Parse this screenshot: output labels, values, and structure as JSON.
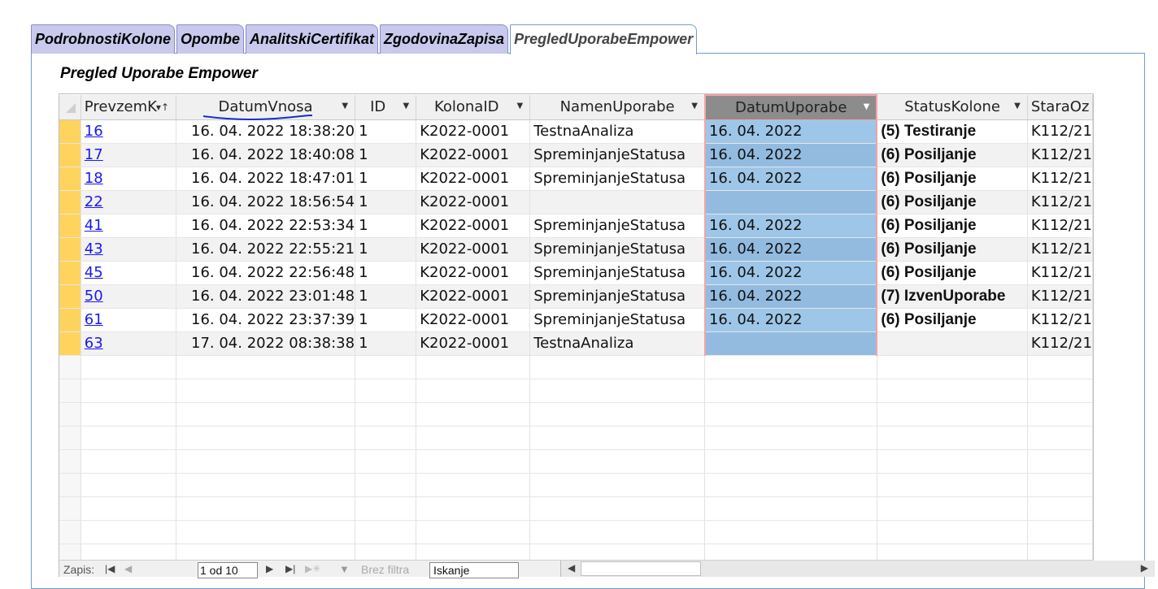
{
  "tabs": [
    {
      "label": "PodrobnostiKolone",
      "active": false
    },
    {
      "label": "Opombe",
      "active": false
    },
    {
      "label": "AnalitskiCertifikat",
      "active": false
    },
    {
      "label": "ZgodovinaZapisa",
      "active": false
    },
    {
      "label": "PregledUporabeEmpower",
      "active": true
    }
  ],
  "panel_title": "Pregled Uporabe Empower",
  "columns": [
    "PrevzemK",
    "DatumVnosa",
    "ID",
    "KolonaID",
    "NamenUporabe",
    "DatumUporabe",
    "StatusKolone",
    "StaraOz"
  ],
  "rows": [
    {
      "prevzem": "16",
      "datum_vnosa": "16. 04. 2022 18:38:20",
      "id": "1",
      "kolona": "K2022-0001",
      "namen": "TestnaAnaliza",
      "datum_uporabe": "16. 04. 2022",
      "status": "(5) Testiranje",
      "stara": "K112/21"
    },
    {
      "prevzem": "17",
      "datum_vnosa": "16. 04. 2022 18:40:08",
      "id": "1",
      "kolona": "K2022-0001",
      "namen": "SpreminjanjeStatusa",
      "datum_uporabe": "16. 04. 2022",
      "status": "(6) Posiljanje",
      "stara": "K112/21"
    },
    {
      "prevzem": "18",
      "datum_vnosa": "16. 04. 2022 18:47:01",
      "id": "1",
      "kolona": "K2022-0001",
      "namen": "SpreminjanjeStatusa",
      "datum_uporabe": "16. 04. 2022",
      "status": "(6) Posiljanje",
      "stara": "K112/21"
    },
    {
      "prevzem": "22",
      "datum_vnosa": "16. 04. 2022 18:56:54",
      "id": "1",
      "kolona": "K2022-0001",
      "namen": "",
      "datum_uporabe": "",
      "status": "(6) Posiljanje",
      "stara": "K112/21"
    },
    {
      "prevzem": "41",
      "datum_vnosa": "16. 04. 2022 22:53:34",
      "id": "1",
      "kolona": "K2022-0001",
      "namen": "SpreminjanjeStatusa",
      "datum_uporabe": "16. 04. 2022",
      "status": "(6) Posiljanje",
      "stara": "K112/21"
    },
    {
      "prevzem": "43",
      "datum_vnosa": "16. 04. 2022 22:55:21",
      "id": "1",
      "kolona": "K2022-0001",
      "namen": "SpreminjanjeStatusa",
      "datum_uporabe": "16. 04. 2022",
      "status": "(6) Posiljanje",
      "stara": "K112/21"
    },
    {
      "prevzem": "45",
      "datum_vnosa": "16. 04. 2022 22:56:48",
      "id": "1",
      "kolona": "K2022-0001",
      "namen": "SpreminjanjeStatusa",
      "datum_uporabe": "16. 04. 2022",
      "status": "(6) Posiljanje",
      "stara": "K112/21"
    },
    {
      "prevzem": "50",
      "datum_vnosa": "16. 04. 2022 23:01:48",
      "id": "1",
      "kolona": "K2022-0001",
      "namen": "SpreminjanjeStatusa",
      "datum_uporabe": "16. 04. 2022",
      "status": "(7) IzvenUporabe",
      "stara": "K112/21"
    },
    {
      "prevzem": "61",
      "datum_vnosa": "16. 04. 2022 23:37:39",
      "id": "1",
      "kolona": "K2022-0001",
      "namen": "SpreminjanjeStatusa",
      "datum_uporabe": "16. 04. 2022",
      "status": "(6) Posiljanje",
      "stara": "K112/21"
    },
    {
      "prevzem": "63",
      "datum_vnosa": "17. 04. 2022 08:38:38",
      "id": "1",
      "kolona": "K2022-0001",
      "namen": "TestnaAnaliza",
      "datum_uporabe": "",
      "status": "",
      "stara": "K112/21"
    }
  ],
  "statusbar": {
    "record_label": "Zapis:",
    "record_value": "1 od 10",
    "nofilter_label": "Brez filtra",
    "search_placeholder": "Iskanje"
  },
  "colors": {
    "tab_bg": "#c9c9ee",
    "selected_column": "#9ec6e8",
    "selected_border": "#f4a3a8",
    "row_selector": "#ffd45e",
    "link": "#1a1aee"
  }
}
